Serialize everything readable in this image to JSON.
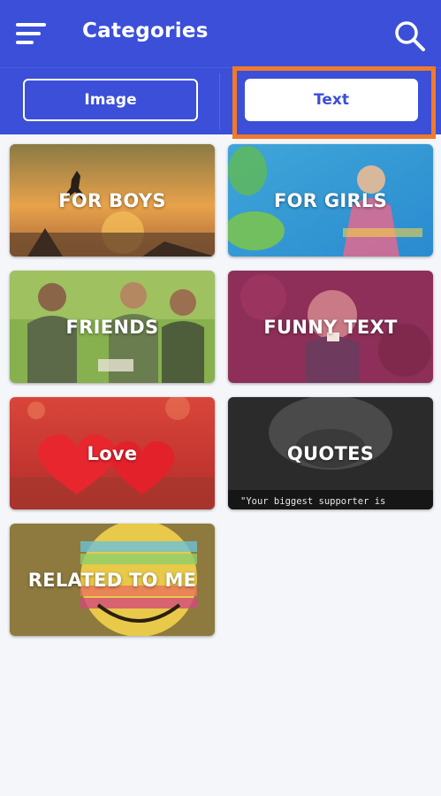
{
  "header": {
    "title": "Categories",
    "menu_icon": "hamburger-menu-icon",
    "search_icon": "search-icon"
  },
  "tabs": [
    {
      "label": "Image",
      "selected": false
    },
    {
      "label": "Text",
      "selected": true
    }
  ],
  "categories": [
    {
      "label": "FOR BOYS"
    },
    {
      "label": "FOR GIRLS"
    },
    {
      "label": "FRIENDS"
    },
    {
      "label": "FUNNY TEXT"
    },
    {
      "label": "Love"
    },
    {
      "label": "QUOTES",
      "caption": "\"Your biggest supporter is"
    },
    {
      "label": "RELATED TO ME"
    }
  ],
  "colors": {
    "primary": "#3b4fd8",
    "highlight": "#f07a2a",
    "background": "#f4f6fa"
  }
}
